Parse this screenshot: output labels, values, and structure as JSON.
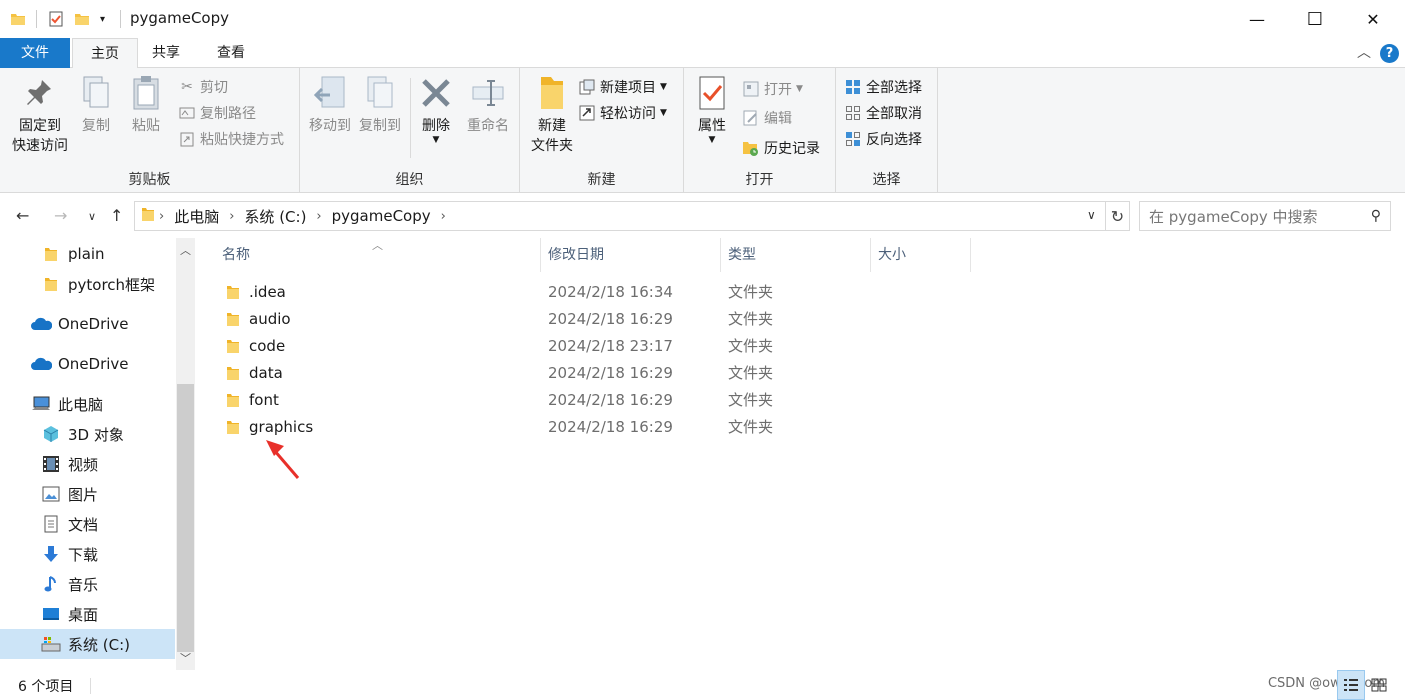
{
  "window": {
    "title": "pygameCopy",
    "minimize": "—",
    "maximize": "☐",
    "close": "✕"
  },
  "ribbon_tabs": [
    {
      "label": "文件"
    },
    {
      "label": "主页"
    },
    {
      "label": "共享"
    },
    {
      "label": "查看"
    }
  ],
  "ribbon": {
    "clipboard": {
      "group_label": "剪贴板",
      "pin_line1": "固定到",
      "pin_line2": "快速访问",
      "copy": "复制",
      "paste": "粘贴",
      "cut": "剪切",
      "copy_path": "复制路径",
      "paste_shortcut": "粘贴快捷方式"
    },
    "organize": {
      "group_label": "组织",
      "move_to": "移动到",
      "copy_to": "复制到",
      "delete": "删除",
      "rename": "重命名"
    },
    "new": {
      "group_label": "新建",
      "new_folder_line1": "新建",
      "new_folder_line2": "文件夹",
      "new_item": "新建项目",
      "easy_access": "轻松访问"
    },
    "open": {
      "group_label": "打开",
      "properties": "属性",
      "open": "打开",
      "edit": "编辑",
      "history": "历史记录"
    },
    "select": {
      "group_label": "选择",
      "select_all": "全部选择",
      "select_none": "全部取消",
      "invert": "反向选择"
    }
  },
  "address": {
    "crumbs": [
      "此电脑",
      "系统 (C:)",
      "pygameCopy"
    ],
    "search_placeholder": "在 pygameCopy 中搜索"
  },
  "sidebar": {
    "items": [
      {
        "label": "plain",
        "icon": "folder-icon"
      },
      {
        "label": "pytorch框架",
        "icon": "folder-icon"
      },
      {
        "label": "OneDrive",
        "icon": "onedrive-icon"
      },
      {
        "label": "OneDrive",
        "icon": "onedrive-icon"
      },
      {
        "label": "此电脑",
        "icon": "computer-icon"
      },
      {
        "label": "3D 对象",
        "icon": "3d-objects-icon"
      },
      {
        "label": "视频",
        "icon": "video-icon"
      },
      {
        "label": "图片",
        "icon": "pictures-icon"
      },
      {
        "label": "文档",
        "icon": "documents-icon"
      },
      {
        "label": "下载",
        "icon": "download-icon"
      },
      {
        "label": "音乐",
        "icon": "music-icon"
      },
      {
        "label": "桌面",
        "icon": "desktop-icon"
      },
      {
        "label": "系统 (C:)",
        "icon": "drive-icon",
        "selected": true
      }
    ]
  },
  "columns": {
    "name": "名称",
    "date": "修改日期",
    "type": "类型",
    "size": "大小"
  },
  "files": [
    {
      "name": ".idea",
      "date": "2024/2/18 16:34",
      "type": "文件夹"
    },
    {
      "name": "audio",
      "date": "2024/2/18 16:29",
      "type": "文件夹"
    },
    {
      "name": "code",
      "date": "2024/2/18 23:17",
      "type": "文件夹"
    },
    {
      "name": "data",
      "date": "2024/2/18 16:29",
      "type": "文件夹"
    },
    {
      "name": "font",
      "date": "2024/2/18 16:29",
      "type": "文件夹"
    },
    {
      "name": "graphics",
      "date": "2024/2/18 16:29",
      "type": "文件夹"
    }
  ],
  "status": {
    "item_count": "6 个项目",
    "watermark": "CSDN @owqqcom"
  },
  "colors": {
    "accent": "#1979ca",
    "selection": "#cce4f7",
    "folder": "#f5c242",
    "annotation_arrow": "#e8302a"
  }
}
